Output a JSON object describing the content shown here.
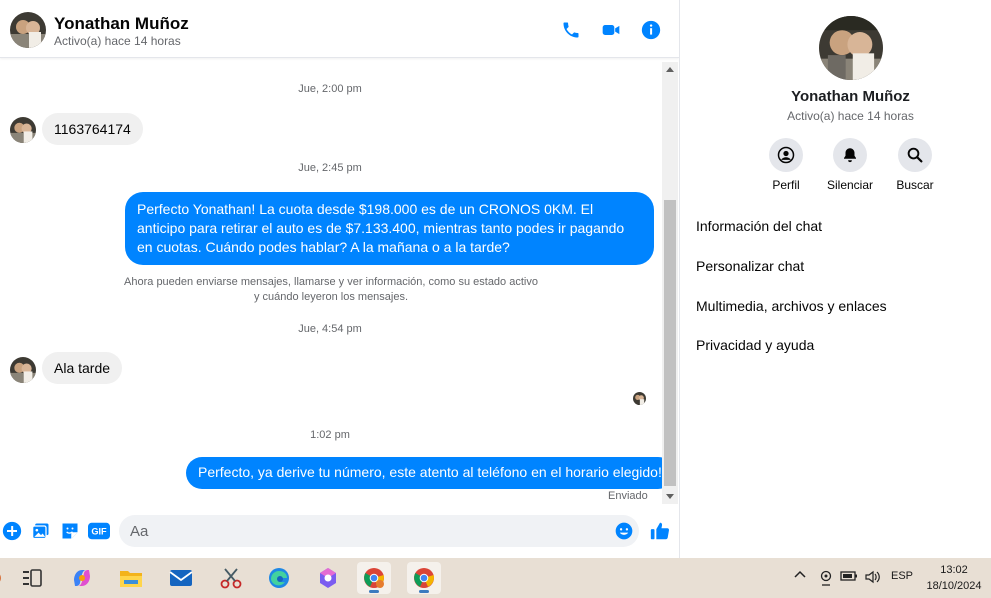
{
  "header": {
    "name": "Yonathan Muñoz",
    "status": "Activo(a) hace 14 horas",
    "icons": [
      "phone-icon",
      "video-icon",
      "info-icon"
    ]
  },
  "messages": {
    "ts1": "Jue, 2:00 pm",
    "msg1": "1163764174",
    "ts2": "Jue, 2:45 pm",
    "msg2": "Perfecto Yonathan!  La cuota desde $198.000 es de un CRONOS 0KM. El anticipo para retirar el auto es de $7.133.400, mientras tanto podes ir pagando en cuotas. Cuándo podes hablar? A la mañana o a la tarde?",
    "system_line1": "Ahora pueden enviarse mensajes, llamarse y ver información, como su estado activo",
    "system_line2": "y cuándo leyeron los mensajes.",
    "ts3": "Jue, 4:54 pm",
    "msg3": "Ala tarde",
    "ts4": "1:02 pm",
    "msg4": "Perfecto, ya derive tu número, este atento al teléfono en el horario elegido!",
    "delivery": "Enviado"
  },
  "composer": {
    "placeholder": "Aa",
    "icons": [
      "plus-icon",
      "gallery-icon",
      "sticker-icon",
      "gif-icon",
      "emoji-icon",
      "like-icon"
    ],
    "gif_label": "GIF"
  },
  "info_panel": {
    "name": "Yonathan Muñoz",
    "status": "Activo(a) hace 14 horas",
    "actions": [
      {
        "label": "Perfil",
        "icon": "profile-icon"
      },
      {
        "label": "Silenciar",
        "icon": "bell-icon"
      },
      {
        "label": "Buscar",
        "icon": "search-icon"
      }
    ],
    "menu": [
      "Información del chat",
      "Personalizar chat",
      "Multimedia, archivos y enlaces",
      "Privacidad y ayuda"
    ]
  },
  "taskbar": {
    "apps": [
      "task-view-icon",
      "copilot-icon",
      "file-explorer-icon",
      "mail-icon",
      "snipping-tool-icon",
      "edge-icon",
      "m365-icon",
      "chrome-icon",
      "chrome-icon"
    ],
    "language": "ESP",
    "time": "13:02",
    "date": "18/10/2024"
  },
  "colors": {
    "accent": "#0084ff",
    "incoming_bubble": "#f0f0f0",
    "taskbar": "#e8dfd4"
  }
}
